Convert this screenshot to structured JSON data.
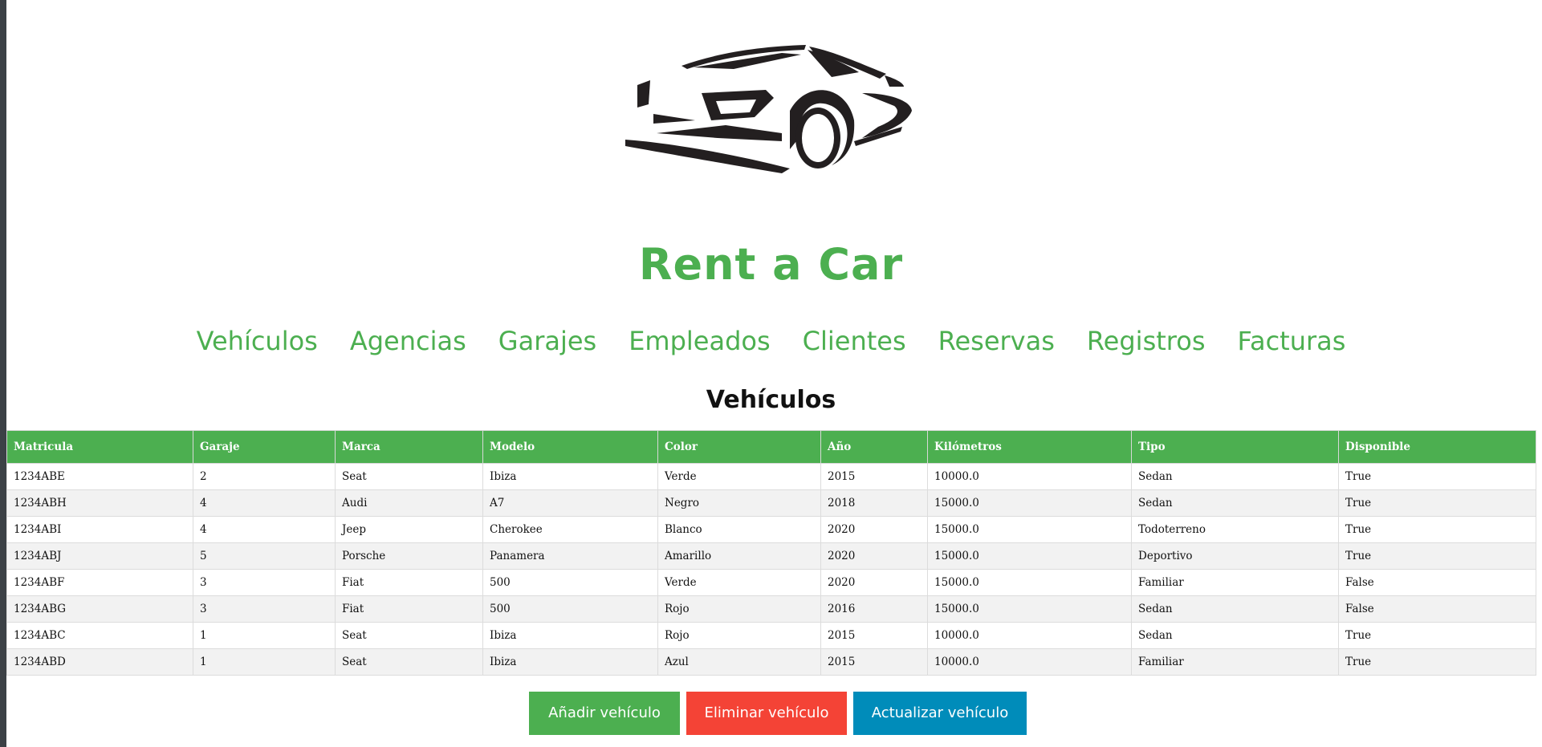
{
  "site": {
    "title": "Rent a Car",
    "logo_icon": "car-silhouette-icon"
  },
  "nav": {
    "items": [
      {
        "label": "Vehículos"
      },
      {
        "label": "Agencias"
      },
      {
        "label": "Garajes"
      },
      {
        "label": "Empleados"
      },
      {
        "label": "Clientes"
      },
      {
        "label": "Reservas"
      },
      {
        "label": "Registros"
      },
      {
        "label": "Facturas"
      }
    ]
  },
  "section": {
    "title": "Vehículos"
  },
  "table": {
    "headers": [
      "Matricula",
      "Garaje",
      "Marca",
      "Modelo",
      "Color",
      "Año",
      "Kilómetros",
      "Tipo",
      "Disponible"
    ],
    "rows": [
      [
        "1234ABE",
        "2",
        "Seat",
        "Ibiza",
        "Verde",
        "2015",
        "10000.0",
        "Sedan",
        "True"
      ],
      [
        "1234ABH",
        "4",
        "Audi",
        "A7",
        "Negro",
        "2018",
        "15000.0",
        "Sedan",
        "True"
      ],
      [
        "1234ABI",
        "4",
        "Jeep",
        "Cherokee",
        "Blanco",
        "2020",
        "15000.0",
        "Todoterreno",
        "True"
      ],
      [
        "1234ABJ",
        "5",
        "Porsche",
        "Panamera",
        "Amarillo",
        "2020",
        "15000.0",
        "Deportivo",
        "True"
      ],
      [
        "1234ABF",
        "3",
        "Fiat",
        "500",
        "Verde",
        "2020",
        "15000.0",
        "Familiar",
        "False"
      ],
      [
        "1234ABG",
        "3",
        "Fiat",
        "500",
        "Rojo",
        "2016",
        "15000.0",
        "Sedan",
        "False"
      ],
      [
        "1234ABC",
        "1",
        "Seat",
        "Ibiza",
        "Rojo",
        "2015",
        "10000.0",
        "Sedan",
        "True"
      ],
      [
        "1234ABD",
        "1",
        "Seat",
        "Ibiza",
        "Azul",
        "2015",
        "10000.0",
        "Familiar",
        "True"
      ]
    ]
  },
  "actions": {
    "add_label": "Añadir vehículo",
    "delete_label": "Eliminar vehículo",
    "update_label": "Actualizar vehículo"
  },
  "colors": {
    "accent_green": "#4caf50",
    "delete_red": "#f44336",
    "update_blue": "#008cba",
    "row_stripe": "#f2f2f2"
  }
}
